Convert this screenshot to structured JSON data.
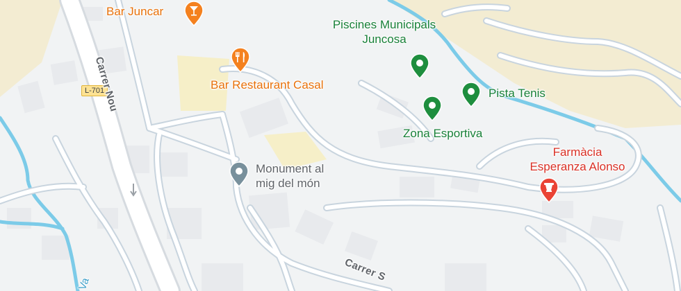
{
  "pois": {
    "bar_juncar": "Bar Juncar",
    "bar_restaurant_casal": "Bar Restaurant Casal",
    "piscines_line1": "Piscines Municipals",
    "piscines_line2": "Juncosa",
    "pista_tenis": "Pista Tenis",
    "zona_esportiva": "Zona Esportiva",
    "farmacia_line1": "Farmàcia",
    "farmacia_line2": "Esperanza Alonso",
    "monument_line1": "Monument al",
    "monument_line2": "mig del món"
  },
  "streets": {
    "carrer_nou": "Carrer Nou",
    "carrer_s": "Carrer S",
    "road_shield": "L-701",
    "water_label": "Va"
  },
  "icons": {
    "bar": "cocktail-icon",
    "restaurant": "fork-knife-icon",
    "sport": "sport-dot-icon",
    "pharmacy": "pharmacy-mortar-icon",
    "landmark": "landmark-icon"
  },
  "colors": {
    "food": "#f4811f",
    "sport": "#1e8e3e",
    "pharmacy": "#ea4335",
    "landmark": "#78909c",
    "water": "#7ccbe8",
    "park": "#f3ecd2"
  }
}
